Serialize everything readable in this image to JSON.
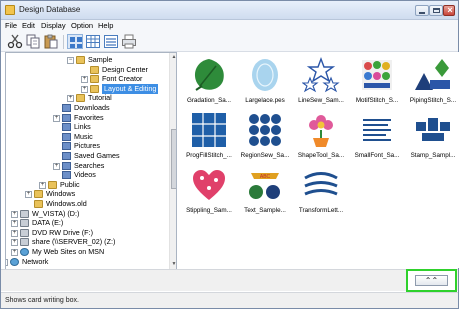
{
  "window": {
    "title": "Design Database"
  },
  "menu": [
    "File",
    "Edit",
    "Display",
    "Option",
    "Help"
  ],
  "tree": [
    {
      "label": "Sample",
      "icon": "folder",
      "expander": "−"
    },
    {
      "label": "Design Center",
      "icon": "folder",
      "expander": ""
    },
    {
      "label": "Font Creator",
      "icon": "folder",
      "expander": "+"
    },
    {
      "label": "Layout & Editing",
      "icon": "folder",
      "expander": "+",
      "selected": true
    },
    {
      "label": "Tutorial",
      "icon": "folder",
      "expander": "+"
    },
    {
      "label": "Downloads",
      "icon": "lib",
      "expander": ""
    },
    {
      "label": "Favorites",
      "icon": "lib",
      "expander": "+"
    },
    {
      "label": "Links",
      "icon": "lib",
      "expander": ""
    },
    {
      "label": "Music",
      "icon": "lib",
      "expander": ""
    },
    {
      "label": "Pictures",
      "icon": "lib",
      "expander": ""
    },
    {
      "label": "Saved Games",
      "icon": "lib",
      "expander": ""
    },
    {
      "label": "Searches",
      "icon": "lib",
      "expander": "+"
    },
    {
      "label": "Videos",
      "icon": "lib",
      "expander": ""
    },
    {
      "label": "Public",
      "icon": "folder",
      "expander": "+"
    },
    {
      "label": "Windows",
      "icon": "folder",
      "expander": "+"
    },
    {
      "label": "Windows.old",
      "icon": "folder",
      "expander": ""
    },
    {
      "label": "W_VISTA) (D:)",
      "icon": "drive",
      "expander": "+"
    },
    {
      "label": "DATA (E:)",
      "icon": "drive",
      "expander": "+"
    },
    {
      "label": "DVD RW Drive (F:)",
      "icon": "drive",
      "expander": "+"
    },
    {
      "label": "share (\\\\SERVER_02) (Z:)",
      "icon": "drive",
      "expander": "+"
    },
    {
      "label": "My Web Sites on MSN",
      "icon": "net",
      "expander": "+"
    },
    {
      "label": "Network",
      "icon": "net",
      "expander": "+"
    }
  ],
  "cards": [
    {
      "caption": "Gradation_Sa...",
      "icon": "leaf"
    },
    {
      "caption": "Largelace.pes",
      "icon": "lace"
    },
    {
      "caption": "LineSew_Sam...",
      "icon": "stars"
    },
    {
      "caption": "MotifStitch_S...",
      "icon": "motif"
    },
    {
      "caption": "PipingStitch_S...",
      "icon": "piping"
    },
    {
      "caption": "ProgFillStitch_...",
      "icon": "progfill"
    },
    {
      "caption": "RegionSew_Sa...",
      "icon": "region"
    },
    {
      "caption": "ShapeTool_Sa...",
      "icon": "flower"
    },
    {
      "caption": "SmallFont_Sa...",
      "icon": "smallfont"
    },
    {
      "caption": "Stamp_Sampl...",
      "icon": "stamp"
    },
    {
      "caption": "Stippling_Sam...",
      "icon": "heart"
    },
    {
      "caption": "Text_Sample...",
      "icon": "text"
    },
    {
      "caption": "TransformLett...",
      "icon": "transform"
    }
  ],
  "collapse_button": {
    "glyph": "⌃⌃"
  },
  "status": {
    "text": "Shows card writing box."
  }
}
